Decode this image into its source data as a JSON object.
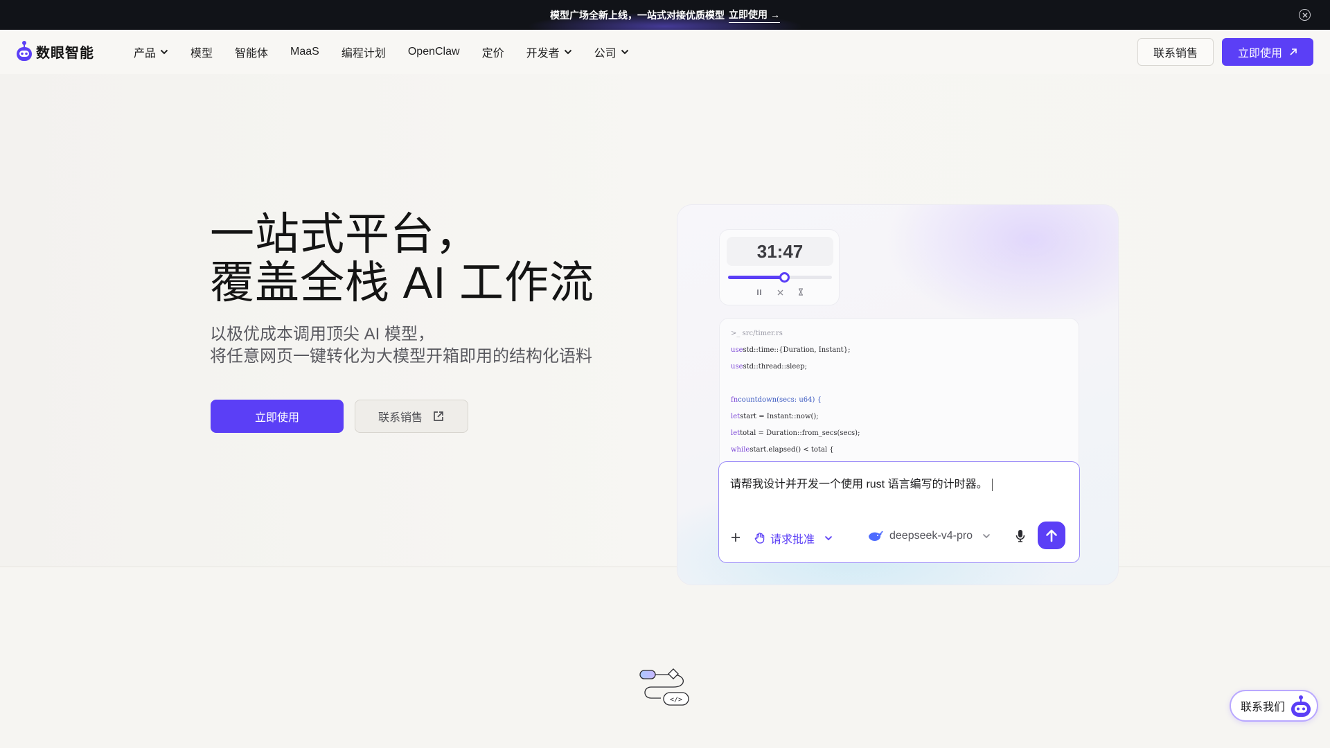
{
  "announcement": {
    "text": "模型广场全新上线，一站式对接优质模型",
    "link_label": "立即使用",
    "link_arrow": "→"
  },
  "nav": {
    "brand": "数眼智能",
    "items": [
      {
        "label": "产品",
        "has_dropdown": true
      },
      {
        "label": "模型",
        "has_dropdown": false
      },
      {
        "label": "智能体",
        "has_dropdown": false
      },
      {
        "label": "MaaS",
        "has_dropdown": false
      },
      {
        "label": "编程计划",
        "has_dropdown": false
      },
      {
        "label": "OpenClaw",
        "has_dropdown": false
      },
      {
        "label": "定价",
        "has_dropdown": false
      },
      {
        "label": "开发者",
        "has_dropdown": true
      },
      {
        "label": "公司",
        "has_dropdown": true
      }
    ],
    "sales_button": "联系销售",
    "use_button": "立即使用"
  },
  "hero": {
    "title_line1": "一站式平台，",
    "title_line2": "覆盖全栈 AI 工作流",
    "subtitle_line1": "以极优成本调用顶尖 AI 模型，",
    "subtitle_line2": "将任意网页一键转化为大模型开箱即用的结构化语料",
    "primary_button": "立即使用",
    "secondary_button": "联系销售"
  },
  "demo": {
    "timer": {
      "display": "31:47",
      "progress": 0.54
    },
    "code": {
      "path": "src/timer.rs",
      "prompt_symbol": ">_",
      "lines": [
        [
          "use",
          "std::time::{Duration, Instant};"
        ],
        [
          "use",
          "std::thread::sleep;"
        ],
        [
          "",
          ""
        ],
        [
          "fn",
          "countdown(secs: u64) {"
        ],
        [
          "let",
          "start = Instant::now();"
        ],
        [
          "let",
          "total = Duration::from_secs(secs);"
        ],
        [
          "while",
          "start.elapsed() < total {"
        ]
      ]
    },
    "prompt": {
      "text": "请帮我设计并开发一个使用 rust 语言编写的计时器。",
      "approval_label": "请求批准",
      "model_label": "deepseek-v4-pro"
    }
  },
  "contact_widget": {
    "label": "联系我们"
  },
  "colors": {
    "accent": "#5b3ff6",
    "announce_bg": "#111318"
  }
}
